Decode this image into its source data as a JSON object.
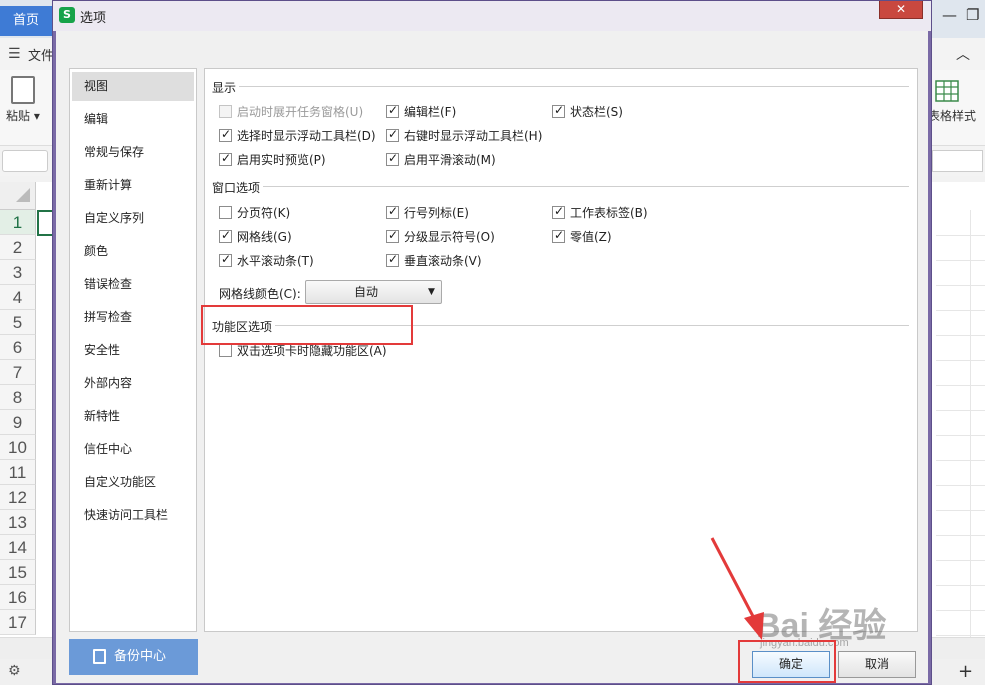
{
  "background_app": {
    "home_tab": "首页",
    "file_menu": "文件",
    "paste_label": "粘贴",
    "table_style_label": "表格样式",
    "row_numbers": [
      "1",
      "2",
      "3",
      "4",
      "5",
      "6",
      "7",
      "8",
      "9",
      "10",
      "11",
      "12",
      "13",
      "14",
      "15",
      "16",
      "17"
    ]
  },
  "dialog": {
    "title": "选项",
    "close_icon": "close-icon",
    "nav": [
      "视图",
      "编辑",
      "常规与保存",
      "重新计算",
      "自定义序列",
      "颜色",
      "错误检查",
      "拼写检查",
      "安全性",
      "外部内容",
      "新特性",
      "信任中心",
      "自定义功能区",
      "快速访问工具栏"
    ],
    "selected_nav": "视图",
    "sections": {
      "display": {
        "title": "显示",
        "options": [
          {
            "label": "启动时展开任务窗格(U)",
            "checked": false,
            "disabled": true
          },
          {
            "label": "编辑栏(F)",
            "checked": true,
            "disabled": false
          },
          {
            "label": "状态栏(S)",
            "checked": true,
            "disabled": false
          },
          {
            "label": "选择时显示浮动工具栏(D)",
            "checked": true,
            "disabled": false
          },
          {
            "label": "右键时显示浮动工具栏(H)",
            "checked": true,
            "disabled": false
          },
          {
            "label": "启用实时预览(P)",
            "checked": true,
            "disabled": false
          },
          {
            "label": "启用平滑滚动(M)",
            "checked": true,
            "disabled": false
          }
        ]
      },
      "window": {
        "title": "窗口选项",
        "options": [
          {
            "label": "分页符(K)",
            "checked": false
          },
          {
            "label": "行号列标(E)",
            "checked": true
          },
          {
            "label": "工作表标签(B)",
            "checked": true
          },
          {
            "label": "网格线(G)",
            "checked": true
          },
          {
            "label": "分级显示符号(O)",
            "checked": true
          },
          {
            "label": "零值(Z)",
            "checked": true
          },
          {
            "label": "水平滚动条(T)",
            "checked": true
          },
          {
            "label": "垂直滚动条(V)",
            "checked": true
          }
        ],
        "grid_color_label": "网格线颜色(C):",
        "grid_color_value": "自动"
      },
      "ribbon": {
        "title": "功能区选项",
        "options": [
          {
            "label": "双击选项卡时隐藏功能区(A)",
            "checked": false
          }
        ]
      }
    },
    "backup_button": "备份中心",
    "ok_button": "确定",
    "cancel_button": "取消"
  },
  "watermark": {
    "text": "Bai 经验",
    "sub": "jingyan.baidu.com"
  },
  "colors": {
    "dialog_border": "#7a6aa6",
    "highlight": "#e33a3a",
    "backup_button": "#6b9ad8",
    "home_tab": "#3e7bd5"
  }
}
